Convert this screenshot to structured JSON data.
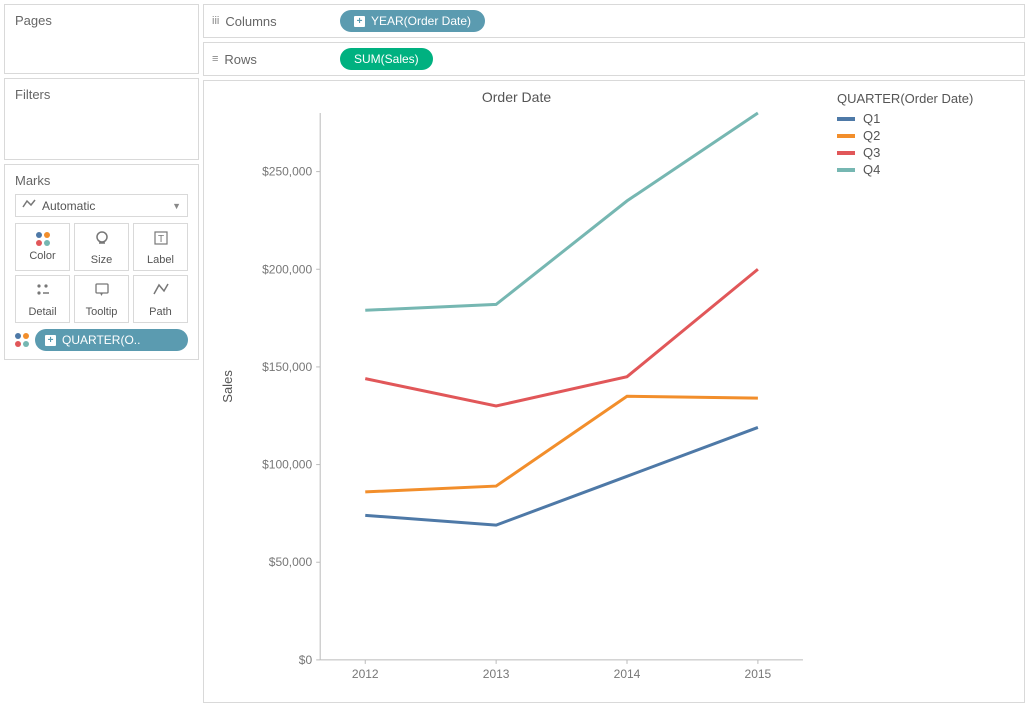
{
  "shelves": {
    "pages_title": "Pages",
    "filters_title": "Filters",
    "marks_title": "Marks",
    "columns_label": "Columns",
    "rows_label": "Rows",
    "columns_pill": "YEAR(Order Date)",
    "rows_pill": "SUM(Sales)"
  },
  "marks": {
    "marktype": "Automatic",
    "buttons": {
      "color": "Color",
      "size": "Size",
      "label": "Label",
      "detail": "Detail",
      "tooltip": "Tooltip",
      "path": "Path"
    },
    "color_pill": "QUARTER(O.."
  },
  "legend": {
    "title": "QUARTER(Order Date)",
    "items": [
      {
        "label": "Q1",
        "color": "#4e79a7"
      },
      {
        "label": "Q2",
        "color": "#f28e2b"
      },
      {
        "label": "Q3",
        "color": "#e15759"
      },
      {
        "label": "Q4",
        "color": "#76b7b2"
      }
    ]
  },
  "chart_data": {
    "type": "line",
    "title": "Order Date",
    "xlabel": "",
    "ylabel": "Sales",
    "categories": [
      "2012",
      "2013",
      "2014",
      "2015"
    ],
    "ylim": [
      0,
      280000
    ],
    "yticks": [
      0,
      50000,
      100000,
      150000,
      200000,
      250000
    ],
    "ytick_labels": [
      "$0",
      "$50,000",
      "$100,000",
      "$150,000",
      "$200,000",
      "$250,000"
    ],
    "series": [
      {
        "name": "Q1",
        "color": "#4e79a7",
        "values": [
          74000,
          69000,
          94000,
          119000
        ]
      },
      {
        "name": "Q2",
        "color": "#f28e2b",
        "values": [
          86000,
          89000,
          135000,
          134000
        ]
      },
      {
        "name": "Q3",
        "color": "#e15759",
        "values": [
          144000,
          130000,
          145000,
          200000
        ]
      },
      {
        "name": "Q4",
        "color": "#76b7b2",
        "values": [
          179000,
          182000,
          235000,
          280000
        ]
      }
    ]
  }
}
